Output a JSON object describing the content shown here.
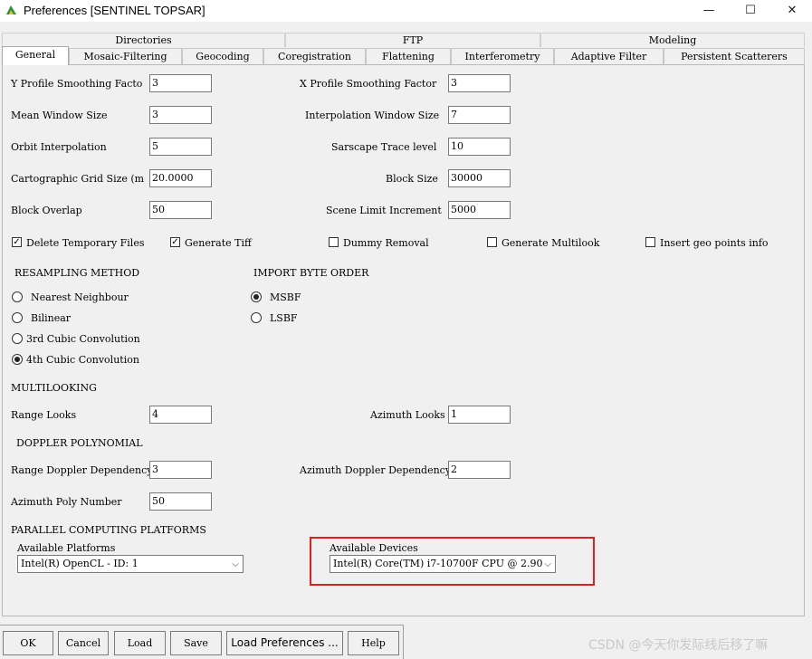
{
  "window": {
    "title": "Preferences [SENTINEL TOPSAR]",
    "minimize": "—",
    "maximize": "☐",
    "close": "✕"
  },
  "tabs": {
    "row1": [
      "Directories",
      "FTP",
      "Modeling"
    ],
    "row2": [
      "General",
      "Mosaic-Filtering",
      "Geocoding",
      "Coregistration",
      "Flattening",
      "Interferometry",
      "Adaptive Filter",
      "Persistent Scatterers"
    ],
    "active": "General"
  },
  "general": {
    "y_profile_label": "Y Profile Smoothing Facto",
    "y_profile_value": "3",
    "x_profile_label": "X Profile Smoothing Factor",
    "x_profile_value": "3",
    "mean_window_label": "Mean Window Size",
    "mean_window_value": "3",
    "interp_window_label": "Interpolation Window Size",
    "interp_window_value": "7",
    "orbit_interp_label": "Orbit Interpolation",
    "orbit_interp_value": "5",
    "trace_level_label": "Sarscape Trace level",
    "trace_level_value": "10",
    "carto_grid_label": "Cartographic Grid Size (m",
    "carto_grid_value": "20.0000",
    "block_size_label": "Block Size",
    "block_size_value": "30000",
    "block_overlap_label": "Block Overlap",
    "block_overlap_value": "50",
    "scene_limit_label": "Scene Limit Increment",
    "scene_limit_value": "5000"
  },
  "checkboxes": [
    {
      "label": "Delete Temporary Files",
      "checked": true
    },
    {
      "label": "Generate Tiff",
      "checked": true
    },
    {
      "label": "Dummy Removal",
      "checked": false
    },
    {
      "label": "Generate Multilook",
      "checked": false
    },
    {
      "label": "Insert geo points info",
      "checked": false
    }
  ],
  "check_mark": "✓",
  "resampling": {
    "title": "RESAMPLING METHOD",
    "options": [
      "Nearest Neighbour",
      "Bilinear",
      "3rd Cubic Convolution",
      "4th Cubic Convolution"
    ],
    "selected": "4th Cubic Convolution"
  },
  "byte_order": {
    "title": "IMPORT BYTE ORDER",
    "options": [
      "MSBF",
      "LSBF"
    ],
    "selected": "MSBF"
  },
  "multilooking": {
    "title": "MULTILOOKING",
    "range_label": "Range Looks",
    "range_value": "4",
    "azimuth_label": "Azimuth Looks",
    "azimuth_value": "1"
  },
  "doppler": {
    "title": "DOPPLER POLYNOMIAL",
    "range_dep_label": "Range Doppler Dependency",
    "range_dep_value": "3",
    "azimuth_dep_label": "Azimuth Doppler Dependency",
    "azimuth_dep_value": "2",
    "azimuth_poly_label": "Azimuth Poly Number",
    "azimuth_poly_value": "50"
  },
  "parallel": {
    "title": "PARALLEL COMPUTING PLATFORMS",
    "platforms_label": "Available Platforms",
    "platforms_value": "Intel(R) OpenCL - ID: 1",
    "devices_label": "Available Devices",
    "devices_value": "Intel(R) Core(TM) i7-10700F CPU @ 2.90",
    "highlight_color": "#e02020"
  },
  "buttons": [
    "OK",
    "Cancel",
    "Load",
    "Save",
    "Load Preferences ...",
    "Help"
  ],
  "watermark": "CSDN @今天你发际线后移了嘛"
}
